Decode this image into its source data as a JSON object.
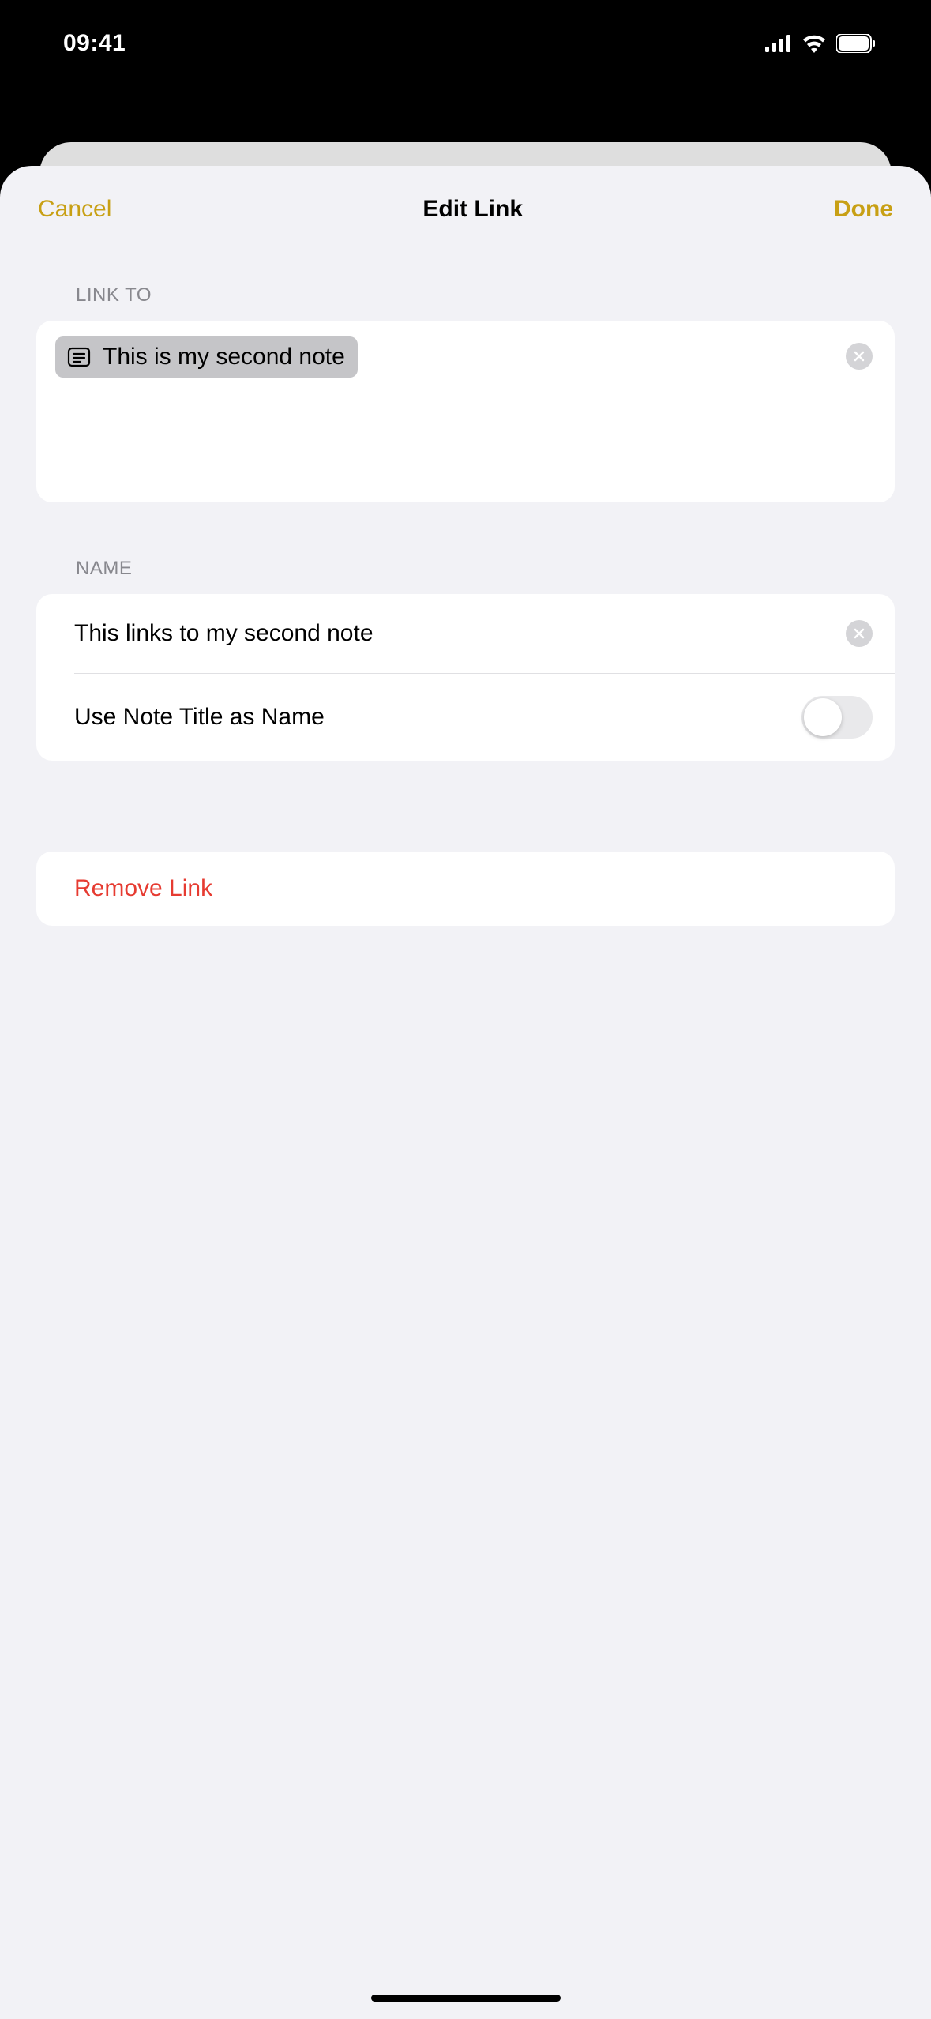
{
  "status": {
    "time": "09:41"
  },
  "header": {
    "cancel": "Cancel",
    "title": "Edit Link",
    "done": "Done"
  },
  "sections": {
    "link_to": {
      "header": "LINK TO",
      "chip_text": "This is my second note"
    },
    "name": {
      "header": "NAME",
      "value": "This links to my second note",
      "toggle_label": "Use Note Title as Name",
      "toggle_on": false
    },
    "remove": {
      "label": "Remove Link"
    }
  }
}
